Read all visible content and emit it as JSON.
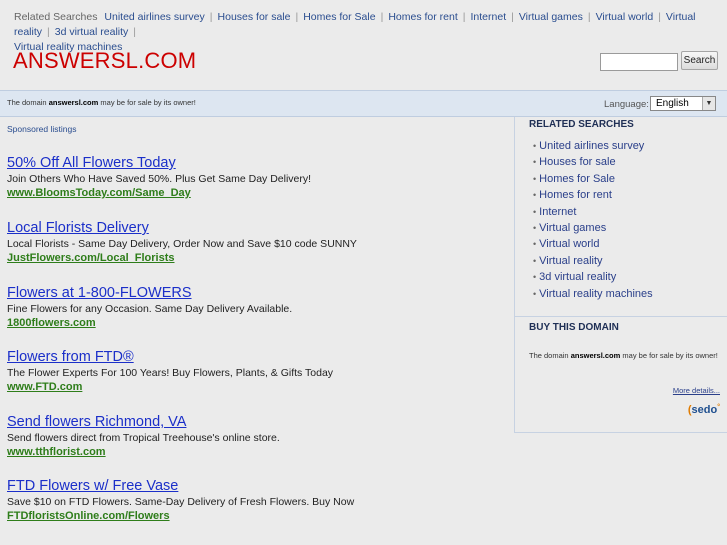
{
  "top_related": {
    "label": "Related Searches",
    "links": [
      "United airlines survey",
      "Houses for sale",
      "Homes for Sale",
      "Homes for rent",
      "Internet",
      "Virtual games",
      "Virtual world",
      "Virtual reality",
      "3d virtual reality",
      "Virtual reality machines"
    ]
  },
  "logo": "ANSWERSL.COM",
  "search": {
    "button_label": "Search",
    "value": ""
  },
  "info_bar": {
    "text_prefix": "The domain ",
    "domain": "answersl.com",
    "text_suffix": " may be for sale by its owner!",
    "language_label": "Language:",
    "language_value": "English"
  },
  "sponsored_label": "Sponsored listings",
  "listings": [
    {
      "title": "50% Off All Flowers Today",
      "desc": "Join Others Who Have Saved 50%. Plus Get Same Day Delivery!",
      "url": "www.BloomsToday.com/Same_Day"
    },
    {
      "title": "Local Florists Delivery",
      "desc": "Local Florists - Same Day Delivery, Order Now and Save $10 code SUNNY",
      "url": "JustFlowers.com/Local_Florists"
    },
    {
      "title": "Flowers at 1-800-FLOWERS",
      "desc": "Fine Flowers for any Occasion. Same Day Delivery Available.",
      "url": "1800flowers.com"
    },
    {
      "title": "Flowers from FTD®",
      "desc": "The Flower Experts For 100 Years! Buy Flowers, Plants, & Gifts Today",
      "url": "www.FTD.com"
    },
    {
      "title": "Send flowers Richmond, VA",
      "desc": "Send flowers direct from Tropical Treehouse's online store.",
      "url": "www.tthflorist.com"
    },
    {
      "title": "FTD Flowers w/ Free Vase",
      "desc": "Save $10 on FTD Flowers. Same-Day Delivery of Fresh Flowers. Buy Now",
      "url": "FTDfloristsOnline.com/Flowers"
    }
  ],
  "right_panel": {
    "related_heading": "RELATED SEARCHES",
    "related_items": [
      "United airlines survey",
      "Houses for sale",
      "Homes for Sale",
      "Homes for rent",
      "Internet",
      "Virtual games",
      "Virtual world",
      "Virtual reality",
      "3d virtual reality",
      "Virtual reality machines"
    ],
    "buy_heading": "BUY THIS DOMAIN",
    "buy_text_prefix": "The domain ",
    "buy_domain": "answersl.com",
    "buy_text_suffix": " may be for sale by its owner!",
    "more_details": "More details...",
    "sedo_logo": "sedo"
  },
  "colors": {
    "logo": "#cc0000",
    "link": "#1b2fc9",
    "url": "#2e7d1a",
    "info_bar": "#dde6f1"
  }
}
